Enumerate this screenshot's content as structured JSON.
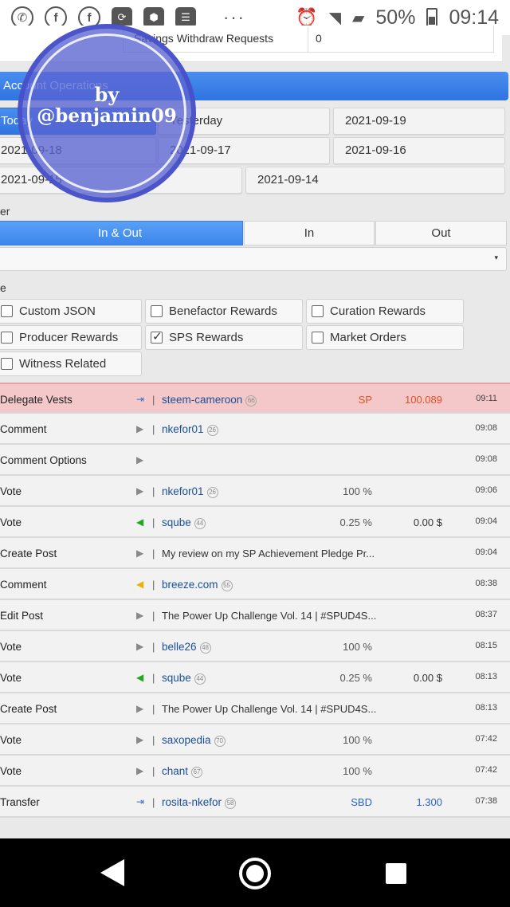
{
  "status_bar": {
    "battery": "50%",
    "time": "09:14",
    "dots": "···",
    "icons": [
      "whatsapp-icon",
      "facebook-icon",
      "facebook-icon",
      "app-icon",
      "app-icon",
      "news-icon"
    ]
  },
  "savings": {
    "label": "Savings Withdraw Requests",
    "value": "0"
  },
  "account_operations": {
    "title": "Account Operations",
    "dates": [
      "Today",
      "Yesterday",
      "2021-09-19",
      "2021-09-18",
      "2021-09-17",
      "2021-09-16",
      "2021-09-15",
      "2021-09-14"
    ]
  },
  "filter": {
    "label": "er",
    "directions": [
      "In & Out",
      "In",
      "Out"
    ],
    "active_direction": "In & Out",
    "select_arrow": "▾"
  },
  "types": {
    "label": "e",
    "options": [
      {
        "label": "Custom JSON",
        "checked": false
      },
      {
        "label": "Benefactor Rewards",
        "checked": false
      },
      {
        "label": "Curation Rewards",
        "checked": false
      },
      {
        "label": "Producer Rewards",
        "checked": false
      },
      {
        "label": "SPS Rewards",
        "checked": true
      },
      {
        "label": "Market Orders",
        "checked": false
      },
      {
        "label": "Witness Related",
        "checked": false
      }
    ]
  },
  "ops": [
    {
      "type": "Delegate Vests",
      "icon": "⇥",
      "icon_color": "tri-blue",
      "sep": "|",
      "who": "steem-cameroon",
      "rep": "66",
      "pct": "SP",
      "amt": "100.089",
      "time": "09:11"
    },
    {
      "type": "Comment",
      "icon": "▶",
      "icon_color": "tri-gray",
      "sep": "|",
      "who": "nkefor01",
      "rep": "26",
      "time": "09:08"
    },
    {
      "type": "Comment Options",
      "icon": "▶",
      "icon_color": "tri-gray",
      "time": "09:08"
    },
    {
      "type": "Vote",
      "icon": "▶",
      "icon_color": "tri-gray",
      "sep": "|",
      "who": "nkefor01",
      "rep": "26",
      "pct": "100 %",
      "time": "09:06"
    },
    {
      "type": "Vote",
      "icon": "◀",
      "icon_color": "tri-green",
      "sep": "|",
      "who": "sqube",
      "rep": "44",
      "pct": "0.25 %",
      "amt": "0.00 $",
      "time": "09:04"
    },
    {
      "type": "Create Post",
      "icon": "▶",
      "icon_color": "tri-gray",
      "sep": "|",
      "detail": "My review on my SP Achievement Pledge Pr...",
      "time": "09:04"
    },
    {
      "type": "Comment",
      "icon": "◀",
      "icon_color": "tri-yellow",
      "sep": "|",
      "who": "breeze.com",
      "rep": "55",
      "time": "08:38"
    },
    {
      "type": "Edit Post",
      "icon": "▶",
      "icon_color": "tri-gray",
      "sep": "|",
      "detail": "The Power Up Challenge Vol. 14 | #SPUD4S...",
      "time": "08:37"
    },
    {
      "type": "Vote",
      "icon": "▶",
      "icon_color": "tri-gray",
      "sep": "|",
      "who": "belle26",
      "rep": "48",
      "pct": "100 %",
      "time": "08:15"
    },
    {
      "type": "Vote",
      "icon": "◀",
      "icon_color": "tri-green",
      "sep": "|",
      "who": "sqube",
      "rep": "44",
      "pct": "0.25 %",
      "amt": "0.00 $",
      "time": "08:13"
    },
    {
      "type": "Create Post",
      "icon": "▶",
      "icon_color": "tri-gray",
      "sep": "|",
      "detail": "The Power Up Challenge Vol. 14 | #SPUD4S...",
      "time": "08:13"
    },
    {
      "type": "Vote",
      "icon": "▶",
      "icon_color": "tri-gray",
      "sep": "|",
      "who": "saxopedia",
      "rep": "70",
      "pct": "100 %",
      "time": "07:42"
    },
    {
      "type": "Vote",
      "icon": "▶",
      "icon_color": "tri-gray",
      "sep": "|",
      "who": "chant",
      "rep": "67",
      "pct": "100 %",
      "time": "07:42"
    },
    {
      "type": "Transfer",
      "icon": "⇥",
      "icon_color": "tri-blue",
      "sep": "|",
      "who": "rosita-nkefor",
      "rep": "58",
      "pct": "SBD",
      "amt": "1.300",
      "time": "07:38",
      "pct_color": "#2a64c8",
      "amt_color": "#2a64c8"
    }
  ],
  "watermark": {
    "by": "by",
    "name": "@benjamin09"
  },
  "colors": {
    "accent": "#2f74e0",
    "highlight_row": "#f4c8c8",
    "sp_orange": "#e0502a",
    "link": "#1a4f9a"
  }
}
